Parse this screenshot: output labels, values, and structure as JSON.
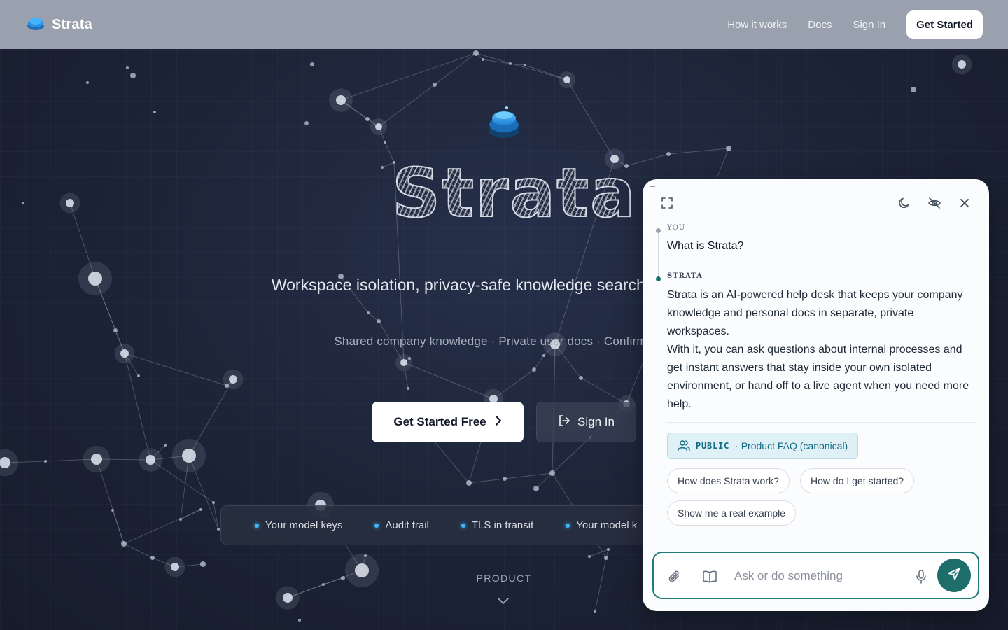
{
  "header": {
    "brand": "Strata",
    "nav": [
      "How it works",
      "Docs",
      "Sign In"
    ],
    "cta": "Get Started"
  },
  "hero": {
    "title": "Strata",
    "subtitle": "Workspace isolation, privacy-safe knowledge search, a browsing.",
    "tagline": "Shared company knowledge · Private user docs · Confirm befo",
    "primary_button": "Get Started Free",
    "secondary_button": "Sign In",
    "features": [
      "Your model keys",
      "Audit trail",
      "TLS in transit",
      "Your model k"
    ],
    "section_label": "PRODUCT"
  },
  "chat": {
    "user_role": "YOU",
    "user_message": "What is Strata?",
    "assistant_role": "STRATA",
    "answer_paragraphs": [
      "Strata is an AI-powered help desk that keeps your company knowledge and personal docs in separate, private workspaces.",
      "With it, you can ask questions about internal processes and get instant answers that stay inside your own isolated environment, or hand off to a live agent when you need more help."
    ],
    "source": {
      "tag": "PUBLIC",
      "label": "· Product FAQ (canonical)"
    },
    "suggestions": [
      "How does Strata work?",
      "How do I get started?",
      "Show me a real example"
    ],
    "composer_placeholder": "Ask or do something"
  },
  "colors": {
    "accent_teal": "#1d6e6a",
    "brand_blue": "#3fb7ff",
    "header_bg": "#9aa1ae",
    "page_bg": "#1b2233"
  }
}
